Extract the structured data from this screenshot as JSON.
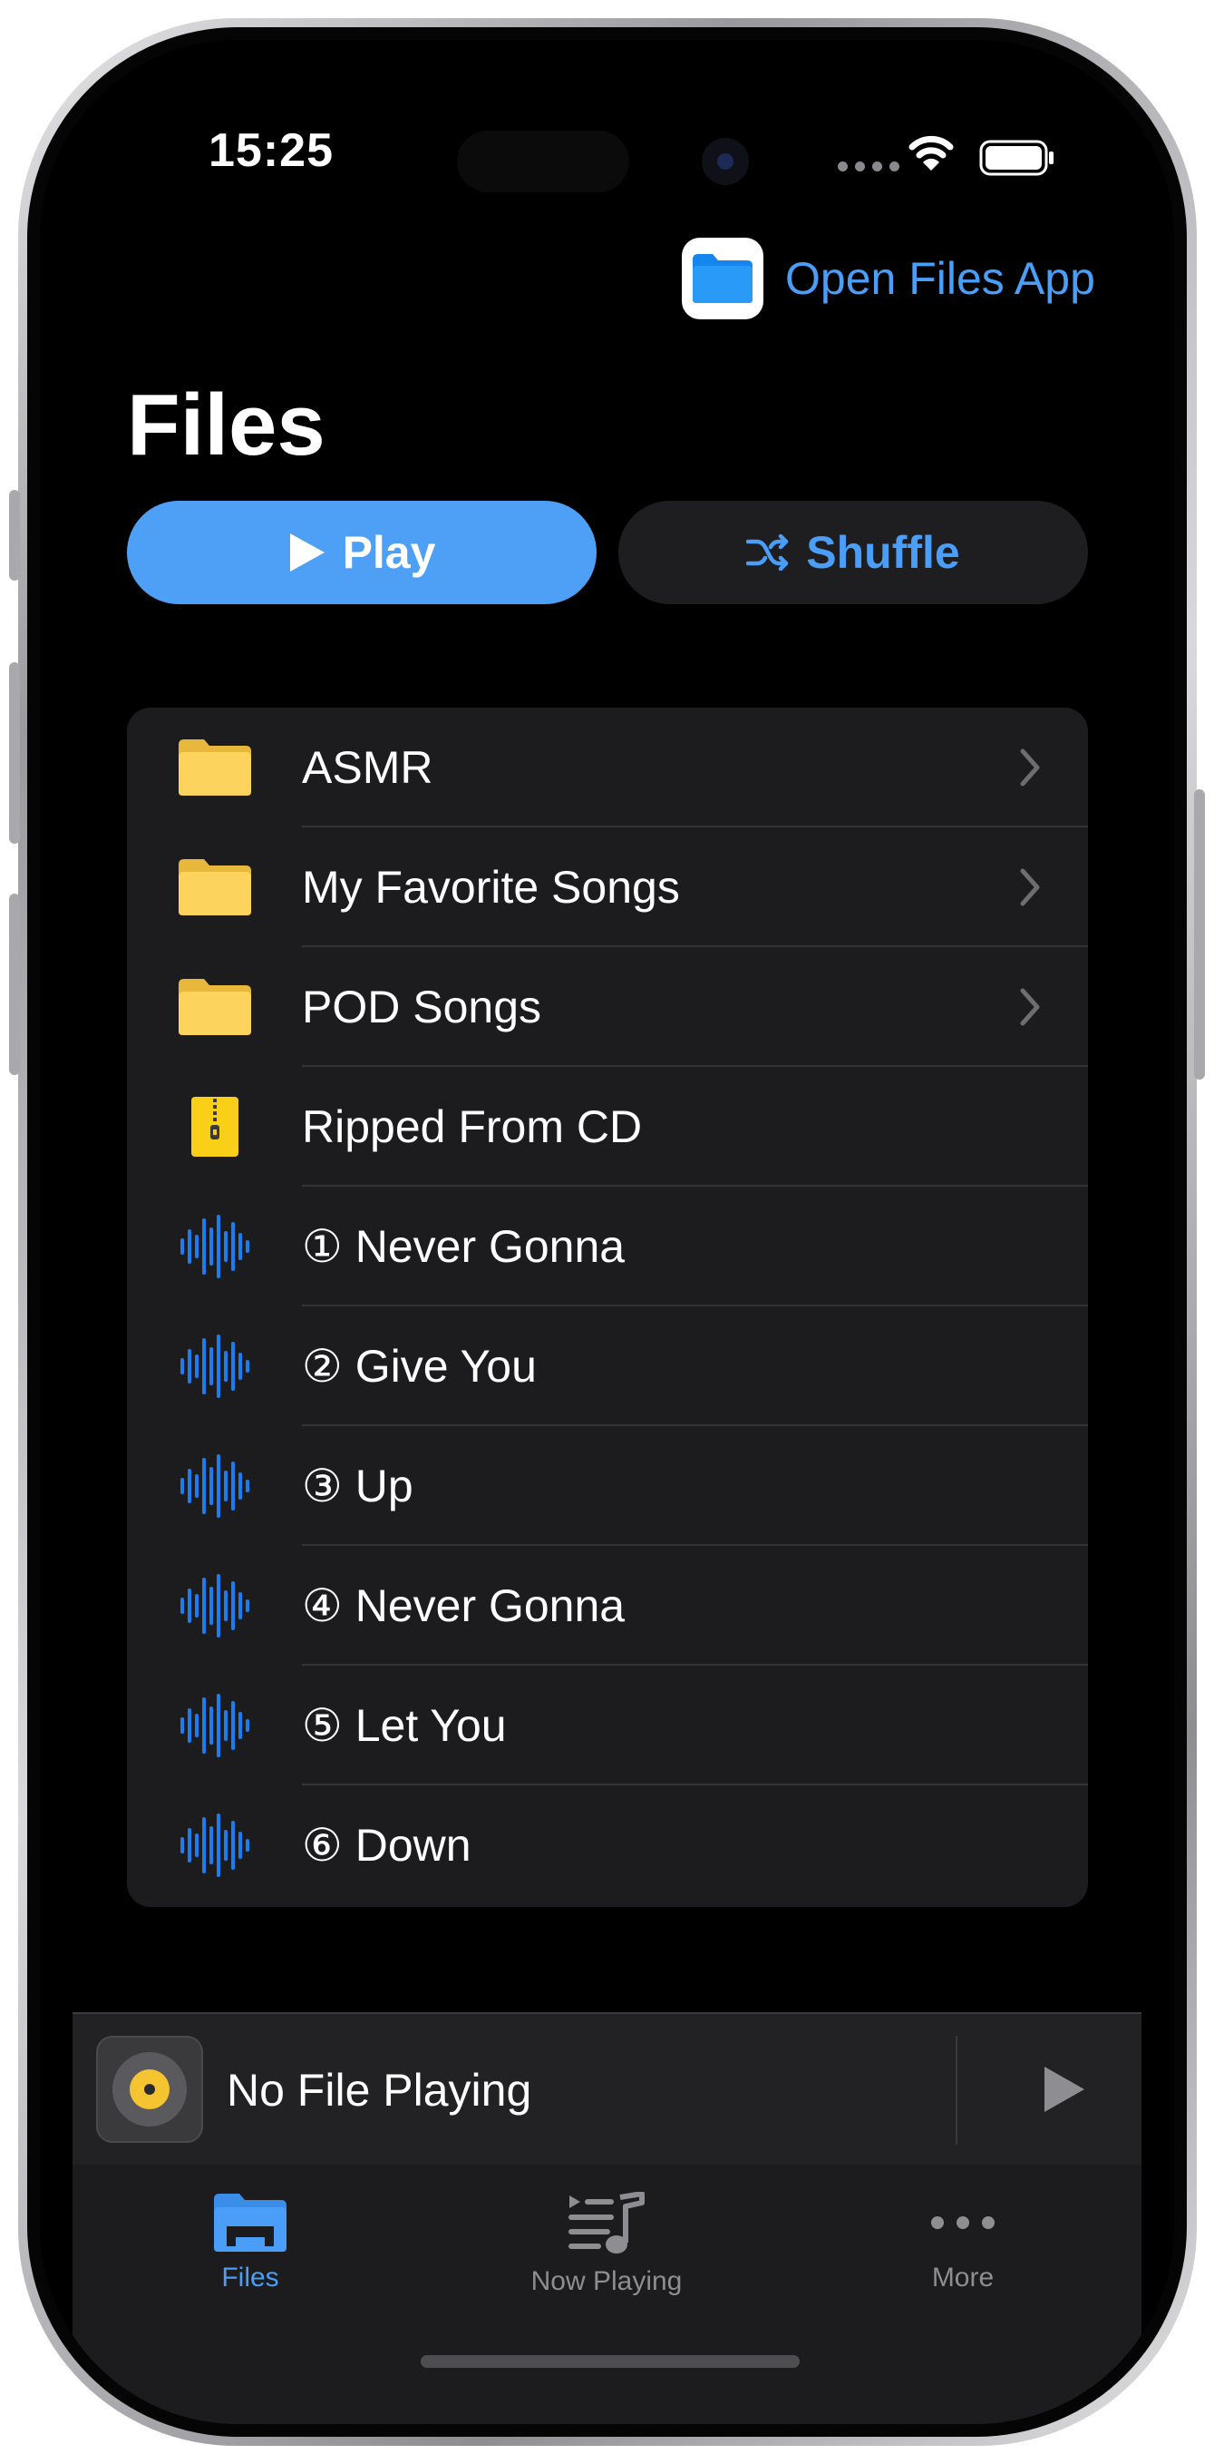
{
  "status_bar": {
    "time": "15:25"
  },
  "header": {
    "open_files_label": "Open Files App",
    "title": "Files"
  },
  "actions": {
    "play_label": "Play",
    "shuffle_label": "Shuffle"
  },
  "files": [
    {
      "label": "ASMR",
      "icon": "folder-icon",
      "chevron": true
    },
    {
      "label": "My Favorite Songs",
      "icon": "folder-icon",
      "chevron": true
    },
    {
      "label": "POD Songs",
      "icon": "folder-icon",
      "chevron": true
    },
    {
      "label": "Ripped From CD",
      "icon": "zip-archive-icon",
      "chevron": false
    },
    {
      "label": "① Never Gonna",
      "icon": "waveform-icon",
      "chevron": false
    },
    {
      "label": "② Give You",
      "icon": "waveform-icon",
      "chevron": false
    },
    {
      "label": "③ Up",
      "icon": "waveform-icon",
      "chevron": false
    },
    {
      "label": "④ Never Gonna",
      "icon": "waveform-icon",
      "chevron": false
    },
    {
      "label": "⑤ Let You",
      "icon": "waveform-icon",
      "chevron": false
    },
    {
      "label": "⑥ Down",
      "icon": "waveform-icon",
      "chevron": false
    }
  ],
  "mini_player": {
    "label": "No File Playing"
  },
  "tab_bar": {
    "tabs": [
      {
        "label": "Files",
        "icon": "folder-tab-icon",
        "active": true
      },
      {
        "label": "Now Playing",
        "icon": "playlist-music-icon",
        "active": false
      },
      {
        "label": "More",
        "icon": "ellipsis-icon",
        "active": false
      }
    ]
  },
  "colors": {
    "accent": "#4a9ef8",
    "background": "#000000",
    "list_background": "#1c1c1e",
    "folder": "#fcd35c",
    "waveform": "#1a7ef0"
  }
}
